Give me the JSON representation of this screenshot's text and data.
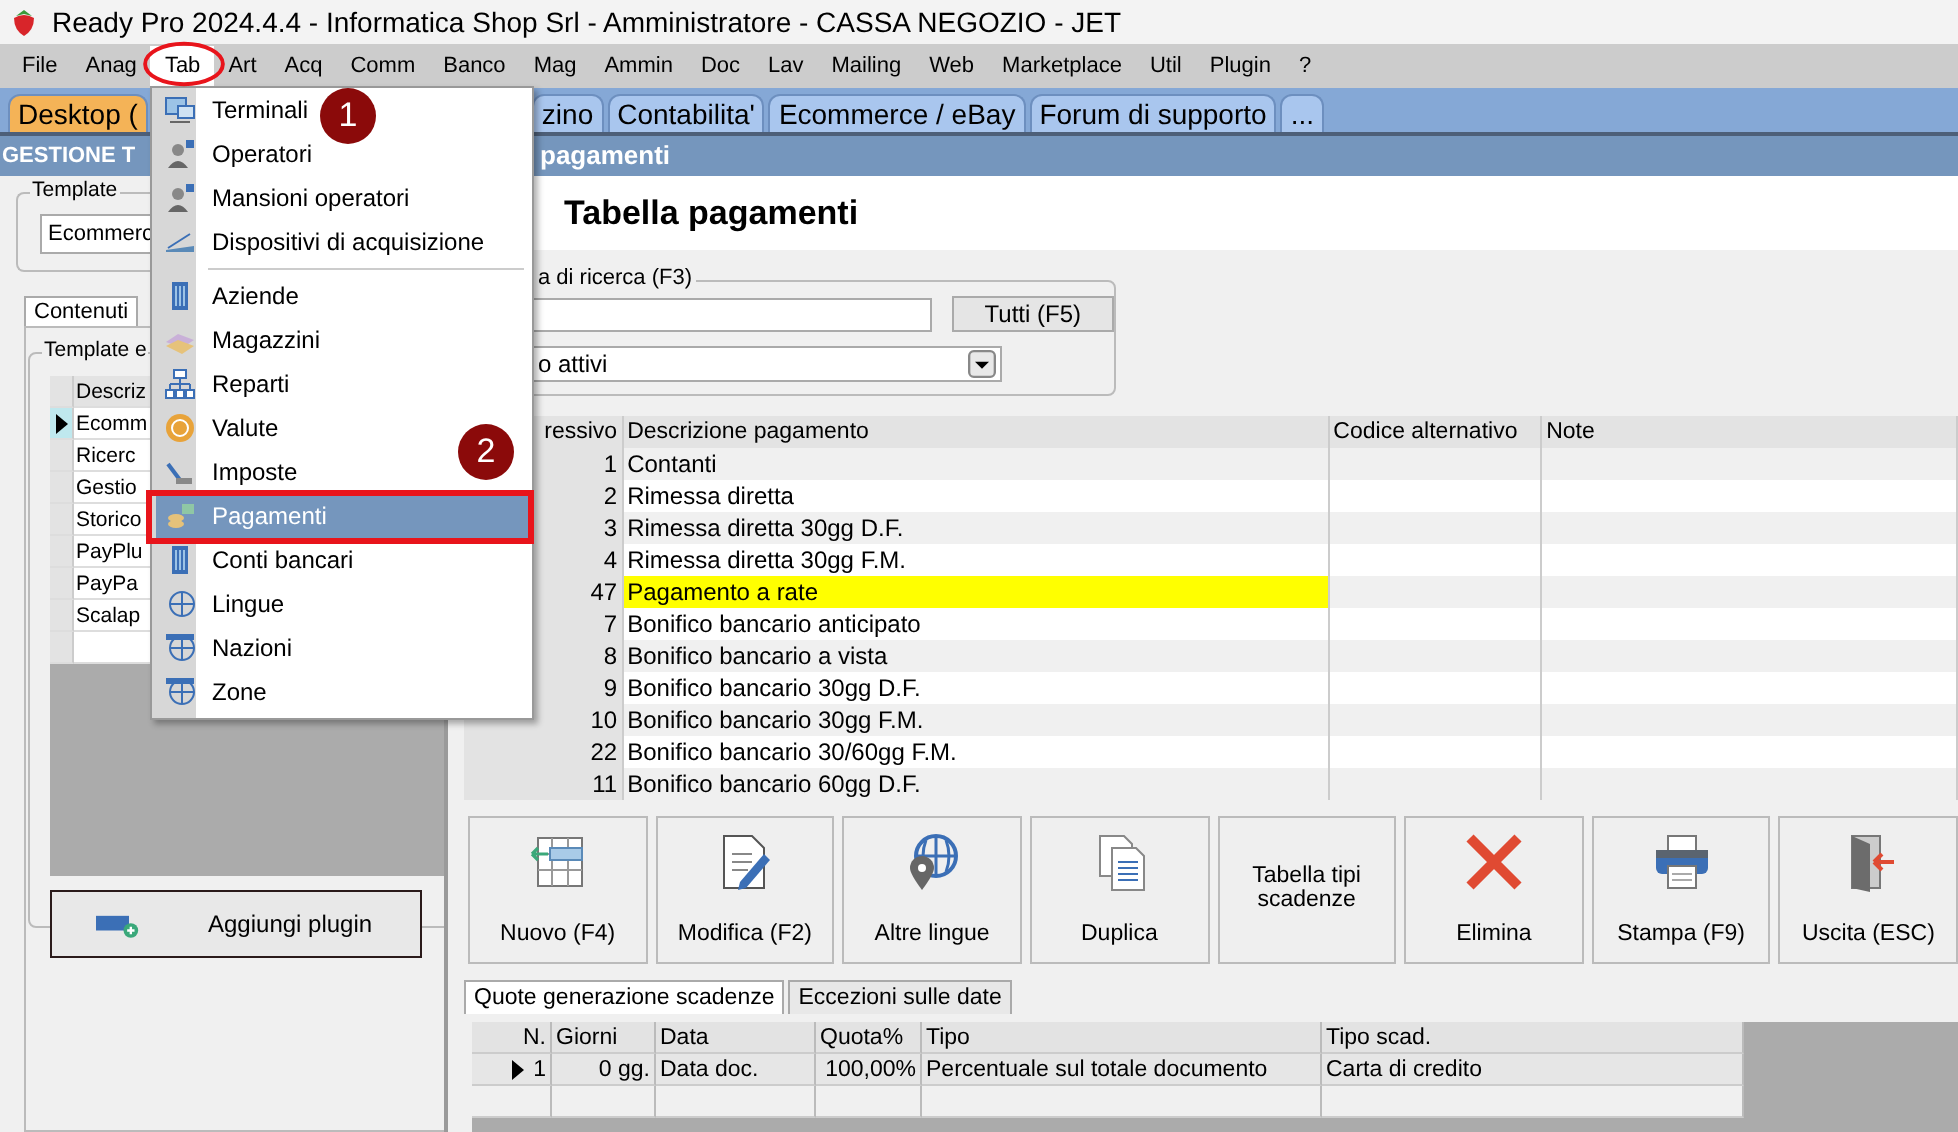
{
  "window": {
    "title": "Ready Pro 2024.4.4 - Informatica Shop Srl - Amministratore - CASSA NEGOZIO - JET"
  },
  "menubar": [
    {
      "label": "File",
      "open": false
    },
    {
      "label": "Anag",
      "open": false
    },
    {
      "label": "Tab",
      "open": true
    },
    {
      "label": "Art",
      "open": false
    },
    {
      "label": "Acq",
      "open": false
    },
    {
      "label": "Comm",
      "open": false
    },
    {
      "label": "Banco",
      "open": false
    },
    {
      "label": "Mag",
      "open": false
    },
    {
      "label": "Ammin",
      "open": false
    },
    {
      "label": "Doc",
      "open": false
    },
    {
      "label": "Lav",
      "open": false
    },
    {
      "label": "Mailing",
      "open": false
    },
    {
      "label": "Web",
      "open": false
    },
    {
      "label": "Marketplace",
      "open": false
    },
    {
      "label": "Util",
      "open": false
    },
    {
      "label": "Plugin",
      "open": false
    },
    {
      "label": "?",
      "open": false
    }
  ],
  "tab_menu": [
    {
      "kind": "item",
      "label": "Terminali",
      "selected": false
    },
    {
      "kind": "item",
      "label": "Operatori",
      "selected": false
    },
    {
      "kind": "item",
      "label": "Mansioni operatori",
      "selected": false
    },
    {
      "kind": "item",
      "label": "Dispositivi di acquisizione",
      "selected": false
    },
    {
      "kind": "separator"
    },
    {
      "kind": "item",
      "label": "Aziende",
      "selected": false
    },
    {
      "kind": "item",
      "label": "Magazzini",
      "selected": false
    },
    {
      "kind": "item",
      "label": "Reparti",
      "selected": false
    },
    {
      "kind": "item",
      "label": "Valute",
      "selected": false
    },
    {
      "kind": "item",
      "label": "Imposte",
      "selected": false
    },
    {
      "kind": "item",
      "label": "Pagamenti",
      "selected": true
    },
    {
      "kind": "item",
      "label": "Conti bancari",
      "selected": false
    },
    {
      "kind": "item",
      "label": "Lingue",
      "selected": false
    },
    {
      "kind": "item",
      "label": "Nazioni",
      "selected": false
    },
    {
      "kind": "item",
      "label": "Zone",
      "selected": false
    }
  ],
  "callouts": [
    {
      "label": "1"
    },
    {
      "label": "2"
    }
  ],
  "module_tabs": [
    {
      "label": "Desktop (",
      "selected": true
    },
    {
      "label": "zino",
      "selected": false
    },
    {
      "label": "Contabilita'",
      "selected": false
    },
    {
      "label": "Ecommerce / eBay",
      "selected": false
    },
    {
      "label": "Forum di supporto",
      "selected": false
    },
    {
      "label": "...",
      "selected": false
    }
  ],
  "left_panel": {
    "header": "GESTIONE T",
    "template_label": "Template",
    "template_value": "Ecommerc",
    "tabs": [
      {
        "label": "Contenuti",
        "selected": true
      }
    ],
    "group_label": "Template e",
    "grid_header": "Descriz",
    "rows": [
      {
        "text": "Ecomm",
        "current": true
      },
      {
        "text": "Ricerc",
        "current": false
      },
      {
        "text": "Gestio",
        "current": false
      },
      {
        "text": "Storico",
        "current": false
      },
      {
        "text": "PayPlu",
        "current": false
      },
      {
        "text": "PayPa",
        "current": false
      },
      {
        "text": "Scalap",
        "current": false
      }
    ],
    "button": "Aggiungi plugin"
  },
  "right_panel": {
    "header": "pagamenti",
    "title": "Tabella pagamenti",
    "search": {
      "label": "a di ricerca (F3)",
      "button": "Tutti (F5)",
      "filter": "o attivi"
    },
    "columns": [
      "ressivo",
      "Descrizione pagamento",
      "Codice alternativo",
      "Note"
    ],
    "rows": [
      {
        "number": "1",
        "description": "Contanti",
        "selected": false
      },
      {
        "number": "2",
        "description": "Rimessa diretta",
        "selected": false
      },
      {
        "number": "3",
        "description": "Rimessa diretta 30gg D.F.",
        "selected": false
      },
      {
        "number": "4",
        "description": "Rimessa diretta 30gg F.M.",
        "selected": false
      },
      {
        "number": "47",
        "description": "Pagamento a rate",
        "selected": true
      },
      {
        "number": "7",
        "description": "Bonifico bancario anticipato",
        "selected": false
      },
      {
        "number": "8",
        "description": "Bonifico bancario a vista",
        "selected": false
      },
      {
        "number": "9",
        "description": "Bonifico bancario 30gg D.F.",
        "selected": false
      },
      {
        "number": "10",
        "description": "Bonifico bancario 30gg F.M.",
        "selected": false
      },
      {
        "number": "22",
        "description": "Bonifico bancario 30/60gg F.M.",
        "selected": false
      },
      {
        "number": "11",
        "description": "Bonifico bancario 60gg D.F.",
        "selected": false
      }
    ],
    "buttons": [
      "Nuovo (F4)",
      "Modifica (F2)",
      "Altre lingue",
      "Duplica",
      "Tabella tipi scadenze",
      "Elimina",
      "Stampa (F9)",
      "Uscita (ESC)"
    ],
    "sub_tabs": [
      {
        "label": "Quote generazione scadenze",
        "selected": true
      },
      {
        "label": "Eccezioni sulle date",
        "selected": false
      }
    ],
    "schedule_columns": [
      "N.",
      "Giorni",
      "Data",
      "Quota%",
      "Tipo",
      "Tipo scad."
    ],
    "schedule_rows": [
      {
        "current": true,
        "cells": [
          "1",
          "0 gg.",
          "Data doc.",
          "100,00%",
          "Percentuale sul totale documento",
          "Carta di credito"
        ]
      }
    ]
  }
}
